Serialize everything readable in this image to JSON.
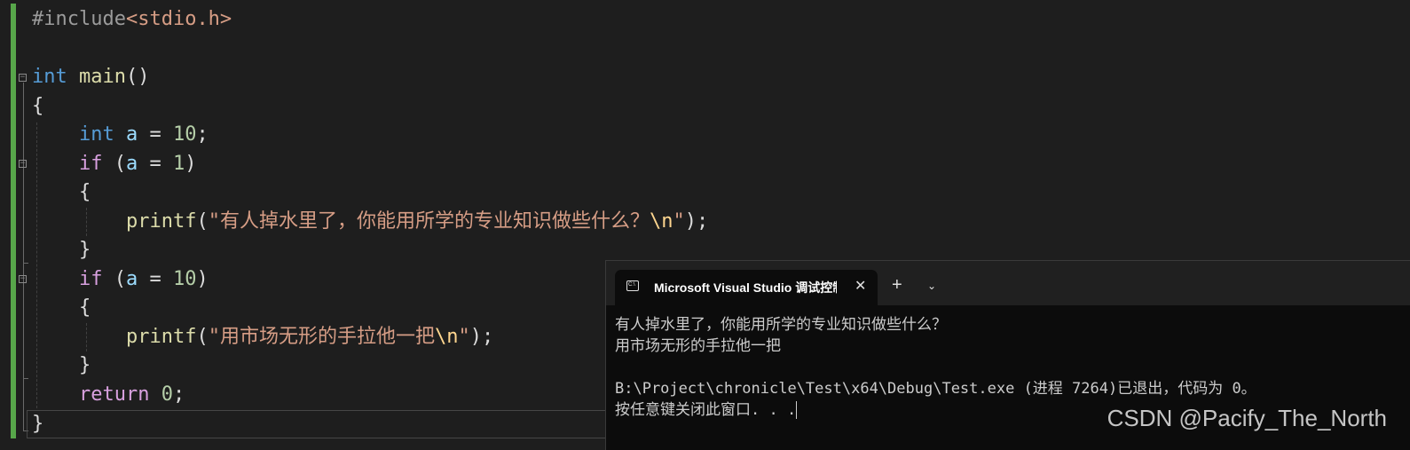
{
  "editor": {
    "lines": [
      {
        "text": "#include<stdio.h>"
      },
      {
        "text": ""
      },
      {
        "text": "int main()"
      },
      {
        "text": "{"
      },
      {
        "text": "    int a = 10;"
      },
      {
        "text": "    if (a = 1)"
      },
      {
        "text": "    {"
      },
      {
        "text": "        printf(\"有人掉水里了，你能用所学的专业知识做些什么？\\n\");"
      },
      {
        "text": "    }"
      },
      {
        "text": "    if (a = 10)"
      },
      {
        "text": "    {"
      },
      {
        "text": "        printf(\"用市场无形的手拉他一把\\n\");"
      },
      {
        "text": "    }"
      },
      {
        "text": "    return 0;"
      },
      {
        "text": "}"
      }
    ],
    "tokens": {
      "include": "#include",
      "header": "<stdio.h>",
      "int": "int",
      "main": "main",
      "parens": "()",
      "open_brace": "{",
      "close_brace": "}",
      "a": "a",
      "eq": " = ",
      "ten": "10",
      "one": "1",
      "semi": ";",
      "if": "if",
      "printf": "printf",
      "str1": "\"有人掉水里了，你能用所学的专业知识做些什么？",
      "str2": "\"用市场无形的手拉他一把",
      "esc": "\\n",
      "quote": "\"",
      "close_call": ");",
      "return": "return",
      "zero": "0"
    }
  },
  "console": {
    "tab_title": "Microsoft Visual Studio 调试控制台",
    "tab_icon_label": "C:\\",
    "close_glyph": "✕",
    "new_tab_glyph": "+",
    "dropdown_glyph": "⌄",
    "output": [
      "有人掉水里了，你能用所学的专业知识做些什么？",
      "用市场无形的手拉他一把",
      "",
      "B:\\Project\\chronicle\\Test\\x64\\Debug\\Test.exe (进程 7264)已退出，代码为 0。",
      "按任意键关闭此窗口. . ."
    ]
  },
  "watermark": "CSDN @Pacify_The_North",
  "colors": {
    "editor_bg": "#1e1e1e",
    "keyword": "#569cd6",
    "control": "#d8a0df",
    "function": "#dcdcaa",
    "variable": "#9cdcfe",
    "number": "#b5cea8",
    "string": "#d69d85",
    "escape": "#ffd68f",
    "console_bg": "#0c0c0c",
    "change_bar": "#57a64a"
  }
}
